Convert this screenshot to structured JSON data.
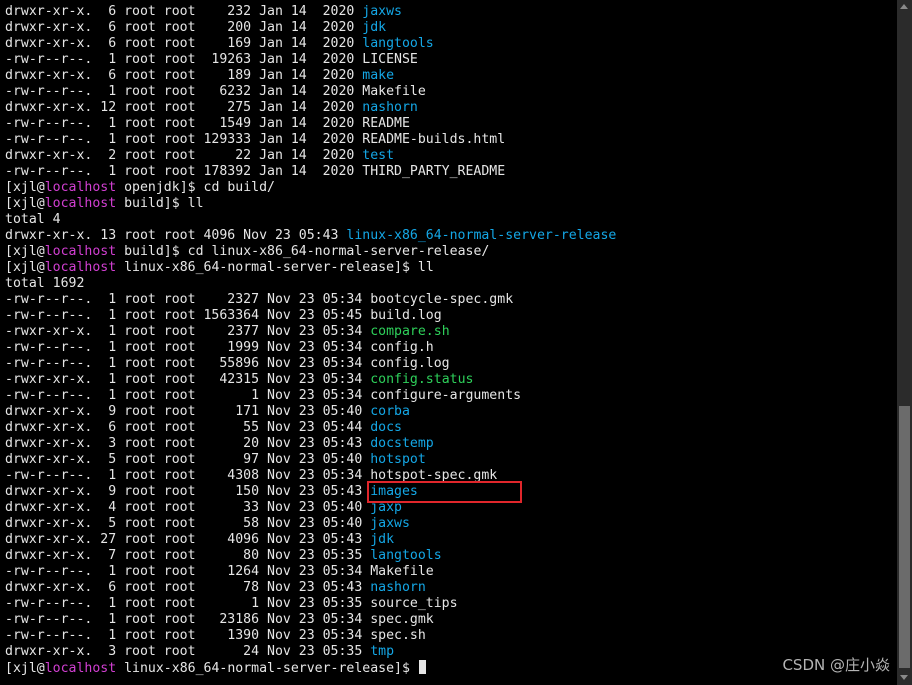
{
  "colors": {
    "background": "#000000",
    "text": "#e6e6e6",
    "directory": "#14a7e6",
    "executable": "#2ed05a",
    "prompt_host": "#d23fd2",
    "highlight_box": "#e0262b"
  },
  "terminal": {
    "lines": [
      {
        "segments": [
          {
            "text": "drwxr-xr-x.  6 root root    232 Jan 14  2020 ",
            "style": "white"
          },
          {
            "text": "jaxws",
            "style": "blue"
          }
        ]
      },
      {
        "segments": [
          {
            "text": "drwxr-xr-x.  6 root root    200 Jan 14  2020 ",
            "style": "white"
          },
          {
            "text": "jdk",
            "style": "blue"
          }
        ]
      },
      {
        "segments": [
          {
            "text": "drwxr-xr-x.  6 root root    169 Jan 14  2020 ",
            "style": "white"
          },
          {
            "text": "langtools",
            "style": "blue"
          }
        ]
      },
      {
        "segments": [
          {
            "text": "-rw-r--r--.  1 root root  19263 Jan 14  2020 LICENSE",
            "style": "white"
          }
        ]
      },
      {
        "segments": [
          {
            "text": "drwxr-xr-x.  6 root root    189 Jan 14  2020 ",
            "style": "white"
          },
          {
            "text": "make",
            "style": "blue"
          }
        ]
      },
      {
        "segments": [
          {
            "text": "-rw-r--r--.  1 root root   6232 Jan 14  2020 Makefile",
            "style": "white"
          }
        ]
      },
      {
        "segments": [
          {
            "text": "drwxr-xr-x. 12 root root    275 Jan 14  2020 ",
            "style": "white"
          },
          {
            "text": "nashorn",
            "style": "blue"
          }
        ]
      },
      {
        "segments": [
          {
            "text": "-rw-r--r--.  1 root root   1549 Jan 14  2020 README",
            "style": "white"
          }
        ]
      },
      {
        "segments": [
          {
            "text": "-rw-r--r--.  1 root root 129333 Jan 14  2020 README-builds.html",
            "style": "white"
          }
        ]
      },
      {
        "segments": [
          {
            "text": "drwxr-xr-x.  2 root root     22 Jan 14  2020 ",
            "style": "white"
          },
          {
            "text": "test",
            "style": "blue"
          }
        ]
      },
      {
        "segments": [
          {
            "text": "-rw-r--r--.  1 root root 178392 Jan 14  2020 THIRD_PARTY_README",
            "style": "white"
          }
        ]
      },
      {
        "segments": [
          {
            "text": "[xjl@",
            "style": "white"
          },
          {
            "text": "localhost",
            "style": "magenta"
          },
          {
            "text": " openjdk]$ cd build/",
            "style": "white"
          }
        ]
      },
      {
        "segments": [
          {
            "text": "[xjl@",
            "style": "white"
          },
          {
            "text": "localhost",
            "style": "magenta"
          },
          {
            "text": " build]$ ll",
            "style": "white"
          }
        ]
      },
      {
        "segments": [
          {
            "text": "total 4",
            "style": "white"
          }
        ]
      },
      {
        "segments": [
          {
            "text": "drwxr-xr-x. 13 root root 4096 Nov 23 05:43 ",
            "style": "white"
          },
          {
            "text": "linux-x86_64-normal-server-release",
            "style": "blue"
          }
        ]
      },
      {
        "segments": [
          {
            "text": "[xjl@",
            "style": "white"
          },
          {
            "text": "localhost",
            "style": "magenta"
          },
          {
            "text": " build]$ cd linux-x86_64-normal-server-release/",
            "style": "white"
          }
        ]
      },
      {
        "segments": [
          {
            "text": "[xjl@",
            "style": "white"
          },
          {
            "text": "localhost",
            "style": "magenta"
          },
          {
            "text": " linux-x86_64-normal-server-release]$ ll",
            "style": "white"
          }
        ]
      },
      {
        "segments": [
          {
            "text": "total 1692",
            "style": "white"
          }
        ]
      },
      {
        "segments": [
          {
            "text": "-rw-r--r--.  1 root root    2327 Nov 23 05:34 bootcycle-spec.gmk",
            "style": "white"
          }
        ]
      },
      {
        "segments": [
          {
            "text": "-rw-r--r--.  1 root root 1563364 Nov 23 05:45 build.log",
            "style": "white"
          }
        ]
      },
      {
        "segments": [
          {
            "text": "-rwxr-xr-x.  1 root root    2377 Nov 23 05:34 ",
            "style": "white"
          },
          {
            "text": "compare.sh",
            "style": "green"
          }
        ]
      },
      {
        "segments": [
          {
            "text": "-rw-r--r--.  1 root root    1999 Nov 23 05:34 config.h",
            "style": "white"
          }
        ]
      },
      {
        "segments": [
          {
            "text": "-rw-r--r--.  1 root root   55896 Nov 23 05:34 config.log",
            "style": "white"
          }
        ]
      },
      {
        "segments": [
          {
            "text": "-rwxr-xr-x.  1 root root   42315 Nov 23 05:34 ",
            "style": "white"
          },
          {
            "text": "config.status",
            "style": "green"
          }
        ]
      },
      {
        "segments": [
          {
            "text": "-rw-r--r--.  1 root root       1 Nov 23 05:34 configure-arguments",
            "style": "white"
          }
        ]
      },
      {
        "segments": [
          {
            "text": "drwxr-xr-x.  9 root root     171 Nov 23 05:40 ",
            "style": "white"
          },
          {
            "text": "corba",
            "style": "blue"
          }
        ]
      },
      {
        "segments": [
          {
            "text": "drwxr-xr-x.  6 root root      55 Nov 23 05:44 ",
            "style": "white"
          },
          {
            "text": "docs",
            "style": "blue"
          }
        ]
      },
      {
        "segments": [
          {
            "text": "drwxr-xr-x.  3 root root      20 Nov 23 05:43 ",
            "style": "white"
          },
          {
            "text": "docstemp",
            "style": "blue"
          }
        ]
      },
      {
        "segments": [
          {
            "text": "drwxr-xr-x.  5 root root      97 Nov 23 05:40 ",
            "style": "white"
          },
          {
            "text": "hotspot",
            "style": "blue"
          }
        ]
      },
      {
        "segments": [
          {
            "text": "-rw-r--r--.  1 root root    4308 Nov 23 05:34 hotspot-spec.gmk",
            "style": "white"
          }
        ]
      },
      {
        "segments": [
          {
            "text": "drwxr-xr-x.  9 root root     150 Nov 23 05:43 ",
            "style": "white"
          },
          {
            "text": "images",
            "style": "blue"
          }
        ]
      },
      {
        "segments": [
          {
            "text": "drwxr-xr-x.  4 root root      33 Nov 23 05:40 ",
            "style": "white"
          },
          {
            "text": "jaxp",
            "style": "blue"
          }
        ]
      },
      {
        "segments": [
          {
            "text": "drwxr-xr-x.  5 root root      58 Nov 23 05:40 ",
            "style": "white"
          },
          {
            "text": "jaxws",
            "style": "blue"
          }
        ]
      },
      {
        "segments": [
          {
            "text": "drwxr-xr-x. 27 root root    4096 Nov 23 05:43 ",
            "style": "white"
          },
          {
            "text": "jdk",
            "style": "blue"
          }
        ]
      },
      {
        "segments": [
          {
            "text": "drwxr-xr-x.  7 root root      80 Nov 23 05:35 ",
            "style": "white"
          },
          {
            "text": "langtools",
            "style": "blue"
          }
        ]
      },
      {
        "segments": [
          {
            "text": "-rw-r--r--.  1 root root    1264 Nov 23 05:34 Makefile",
            "style": "white"
          }
        ]
      },
      {
        "segments": [
          {
            "text": "drwxr-xr-x.  6 root root      78 Nov 23 05:43 ",
            "style": "white"
          },
          {
            "text": "nashorn",
            "style": "blue"
          }
        ]
      },
      {
        "segments": [
          {
            "text": "-rw-r--r--.  1 root root       1 Nov 23 05:35 source_tips",
            "style": "white"
          }
        ]
      },
      {
        "segments": [
          {
            "text": "-rw-r--r--.  1 root root   23186 Nov 23 05:34 spec.gmk",
            "style": "white"
          }
        ]
      },
      {
        "segments": [
          {
            "text": "-rw-r--r--.  1 root root    1390 Nov 23 05:34 spec.sh",
            "style": "white"
          }
        ]
      },
      {
        "segments": [
          {
            "text": "drwxr-xr-x.  3 root root      24 Nov 23 05:35 ",
            "style": "white"
          },
          {
            "text": "tmp",
            "style": "blue"
          }
        ]
      },
      {
        "segments": [
          {
            "text": "[xjl@",
            "style": "white"
          },
          {
            "text": "localhost",
            "style": "magenta"
          },
          {
            "text": " linux-x86_64-normal-server-release]$ ",
            "style": "white"
          }
        ],
        "cursor": true
      }
    ]
  },
  "watermark": "CSDN @庄小焱"
}
